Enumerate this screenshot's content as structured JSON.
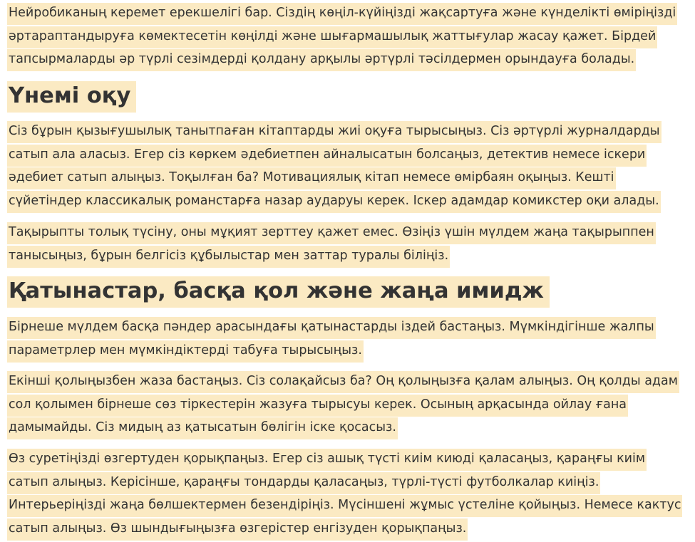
{
  "article": {
    "intro": "Нейробиканың керемет ерекшелігі бар. Сіздің көңіл-күйіңізді жақсартуға және күнделікті өміріңізді әртараптандыруға көмектесетін көңілді және шығармашылық жаттығулар жасау қажет. Бірдей тапсырмаларды әр түрлі сезімдерді қолдану арқылы әртүрлі тәсілдермен орындауға болады.",
    "sections": [
      {
        "heading": "Үнемі оқу",
        "paragraphs": [
          "Сіз бұрын қызығушылық танытпаған кітаптарды жиі оқуға тырысыңыз. Сіз әртүрлі журналдарды сатып ала аласыз. Егер сіз көркем әдебиетпен айналысатын болсаңыз, детектив немесе іскери әдебиет сатып алыңыз. Тоқылған ба? Мотивациялық кітап немесе өмірбаян оқыңыз. Кешті сүйетіндер классикалық романстарға назар аударуы керек. Іскер адамдар комикстер оқи алады.",
          "Тақырыпты толық түсіну, оны мұқият зерттеу қажет емес. Өзіңіз үшін мүлдем жаңа тақырыппен танысыңыз, бұрын белгісіз құбылыстар мен заттар туралы біліңіз."
        ]
      },
      {
        "heading": "Қатынастар, басқа қол және жаңа имидж",
        "paragraphs": [
          "Бірнеше мүлдем басқа пәндер арасындағы қатынастарды іздей бастаңыз. Мүмкіндігінше жалпы параметрлер мен мүмкіндіктерді табуға тырысыңыз.",
          "Екінші қолыңызбен жаза бастаңыз. Сіз солақайсыз ба? Оң қолыңызға қалам алыңыз. Оң қолды адам сол қолымен бірнеше сөз тіркестерін жазуға тырысуы керек. Осының арқасында ойлау ғана дамымайды. Сіз мидың аз қатысатын бөлігін іске қосасыз.",
          "Өз суретіңізді өзгертуден қорықпаңыз. Егер сіз ашық түсті киім киюді қаласаңыз, қараңғы киім сатып алыңыз. Керісінше, қараңғы тондарды қаласаңыз, түрлі-түсті футболкалар киіңіз. Интерьеріңізді жаңа бөлшектермен безендіріңіз. Мүсіншені жұмыс үстеліне қойыңыз. Немесе кактус сатып алыңыз. Өз шындығыңызға өзгерістер енгізуден қорықпаңыз."
        ]
      }
    ]
  },
  "colors": {
    "highlight": "#fbeac3",
    "text": "#333333",
    "background": "#ffffff"
  }
}
